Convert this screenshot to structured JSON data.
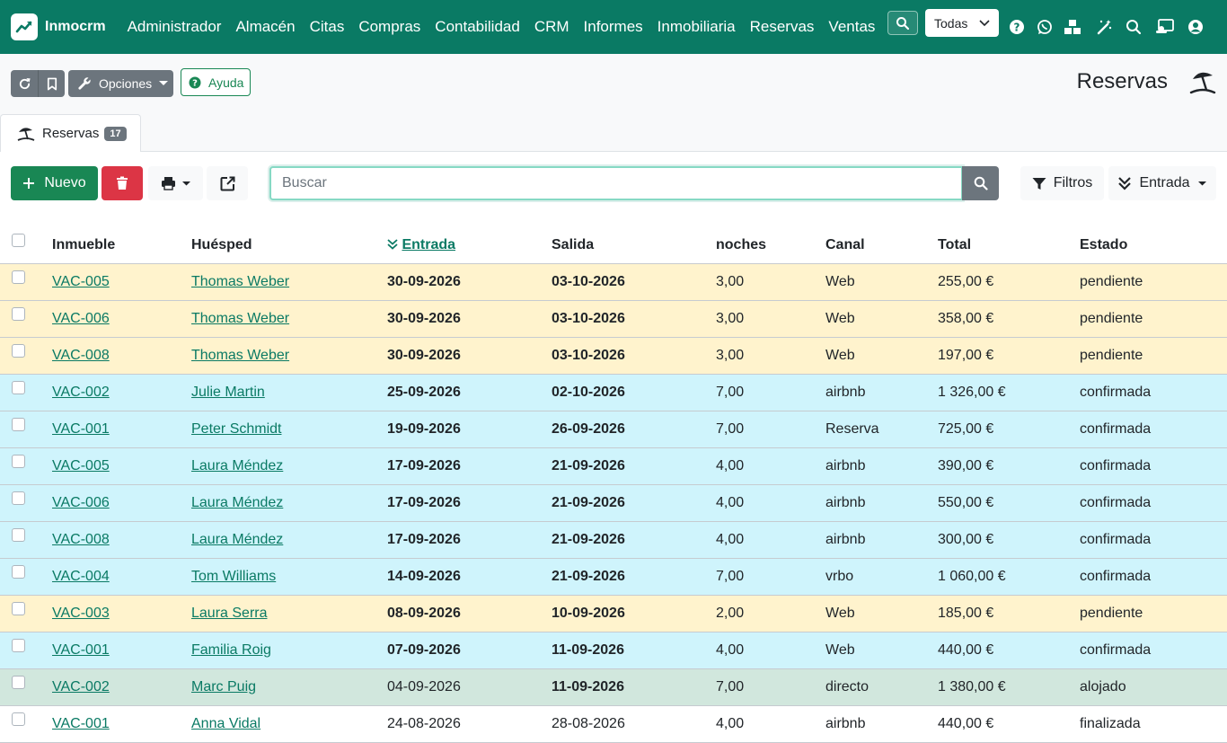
{
  "app": {
    "brand": "Inmocrm",
    "menu": [
      "Administrador",
      "Almacén",
      "Citas",
      "Compras",
      "Contabilidad",
      "CRM",
      "Informes",
      "Inmobiliaria",
      "Reservas",
      "Ventas"
    ],
    "company_select": "Todas"
  },
  "header": {
    "options_label": "Opciones",
    "help_label": "Ayuda",
    "title": "Reservas"
  },
  "tab": {
    "label": "Reservas",
    "count": "17"
  },
  "toolbar": {
    "new_label": "Nuevo",
    "search_placeholder": "Buscar",
    "filters_label": "Filtros",
    "order_label": "Entrada"
  },
  "table": {
    "columns": [
      "Inmueble",
      "Huésped",
      "Entrada",
      "Salida",
      "noches",
      "Canal",
      "Total",
      "Estado"
    ],
    "rows": [
      {
        "inmueble": "VAC-005",
        "huesped": "Thomas Weber",
        "entrada": "30-09-2026",
        "salida": "03-10-2026",
        "noches": "3,00",
        "canal": "Web",
        "total": "255,00 €",
        "estado": "pendiente"
      },
      {
        "inmueble": "VAC-006",
        "huesped": "Thomas Weber",
        "entrada": "30-09-2026",
        "salida": "03-10-2026",
        "noches": "3,00",
        "canal": "Web",
        "total": "358,00 €",
        "estado": "pendiente"
      },
      {
        "inmueble": "VAC-008",
        "huesped": "Thomas Weber",
        "entrada": "30-09-2026",
        "salida": "03-10-2026",
        "noches": "3,00",
        "canal": "Web",
        "total": "197,00 €",
        "estado": "pendiente"
      },
      {
        "inmueble": "VAC-002",
        "huesped": "Julie Martin",
        "entrada": "25-09-2026",
        "salida": "02-10-2026",
        "noches": "7,00",
        "canal": "airbnb",
        "total": "1 326,00 €",
        "estado": "confirmada"
      },
      {
        "inmueble": "VAC-001",
        "huesped": "Peter Schmidt",
        "entrada": "19-09-2026",
        "salida": "26-09-2026",
        "noches": "7,00",
        "canal": "Reserva",
        "total": "725,00 €",
        "estado": "confirmada"
      },
      {
        "inmueble": "VAC-005",
        "huesped": "Laura Méndez",
        "entrada": "17-09-2026",
        "salida": "21-09-2026",
        "noches": "4,00",
        "canal": "airbnb",
        "total": "390,00 €",
        "estado": "confirmada"
      },
      {
        "inmueble": "VAC-006",
        "huesped": "Laura Méndez",
        "entrada": "17-09-2026",
        "salida": "21-09-2026",
        "noches": "4,00",
        "canal": "airbnb",
        "total": "550,00 €",
        "estado": "confirmada"
      },
      {
        "inmueble": "VAC-008",
        "huesped": "Laura Méndez",
        "entrada": "17-09-2026",
        "salida": "21-09-2026",
        "noches": "4,00",
        "canal": "airbnb",
        "total": "300,00 €",
        "estado": "confirmada"
      },
      {
        "inmueble": "VAC-004",
        "huesped": "Tom Williams",
        "entrada": "14-09-2026",
        "salida": "21-09-2026",
        "noches": "7,00",
        "canal": "vrbo",
        "total": "1 060,00 €",
        "estado": "confirmada"
      },
      {
        "inmueble": "VAC-003",
        "huesped": "Laura Serra",
        "entrada": "08-09-2026",
        "salida": "10-09-2026",
        "noches": "2,00",
        "canal": "Web",
        "total": "185,00 €",
        "estado": "pendiente"
      },
      {
        "inmueble": "VAC-001",
        "huesped": "Familia Roig",
        "entrada": "07-09-2026",
        "salida": "11-09-2026",
        "noches": "4,00",
        "canal": "Web",
        "total": "440,00 €",
        "estado": "confirmada"
      },
      {
        "inmueble": "VAC-002",
        "huesped": "Marc Puig",
        "entrada": "04-09-2026",
        "salida": "11-09-2026",
        "noches": "7,00",
        "canal": "directo",
        "total": "1 380,00 €",
        "estado": "alojado"
      },
      {
        "inmueble": "VAC-001",
        "huesped": "Anna Vidal",
        "entrada": "24-08-2026",
        "salida": "28-08-2026",
        "noches": "4,00",
        "canal": "airbnb",
        "total": "440,00 €",
        "estado": "finalizada"
      }
    ]
  },
  "colors": {
    "primary": "#0a7a64",
    "pendiente": "#fff3cd",
    "confirmada": "#cff4fc",
    "alojado": "#d1e7dd",
    "success": "#198754",
    "danger": "#dc3545",
    "secondary": "#6c757d"
  },
  "icons": [
    "chart-line-icon",
    "search-icon",
    "chevron-down-icon",
    "question-circle-icon",
    "whatsapp-icon",
    "cubes-icon",
    "magic-wand-icon",
    "search-icon",
    "id-card-icon",
    "user-circle-icon",
    "refresh-icon",
    "bookmark-icon",
    "wrench-icon",
    "umbrella-beach-icon",
    "plus-icon",
    "trash-icon",
    "print-icon",
    "external-link-icon",
    "filter-icon",
    "sort-down-icon"
  ]
}
